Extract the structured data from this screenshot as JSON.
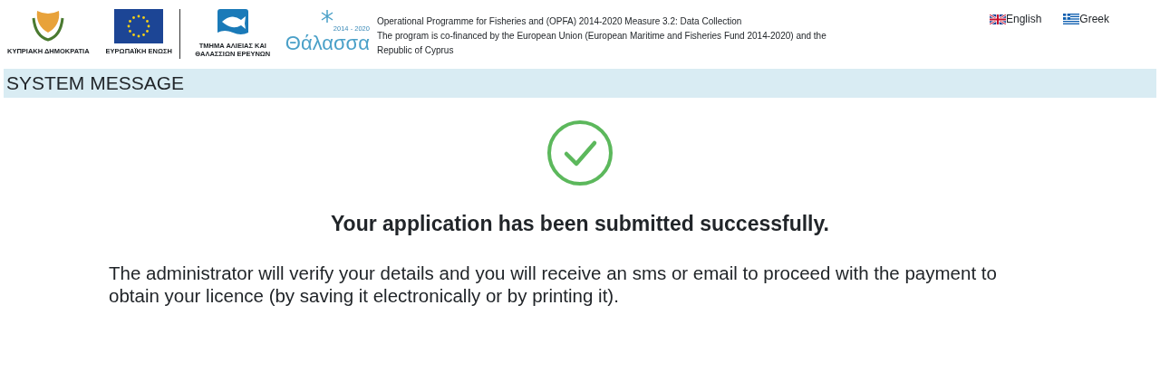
{
  "header": {
    "logos": [
      {
        "kind": "crest",
        "caption": "ΚΥΠΡΙΑΚΗ ΔΗΜΟΚΡΑΤΙΑ"
      },
      {
        "kind": "eu",
        "caption": "ΕΥΡΩΠΑΪΚΗ ΕΝΩΣΗ"
      },
      {
        "kind": "fish",
        "caption": "ΤΜΗΜΑ ΑΛΙΕΙΑΣ ΚΑΙ ΘΑΛΑΣΣΙΩΝ ΕΡΕΥΝΩΝ"
      },
      {
        "kind": "thalassa",
        "caption": "Θάλασσα",
        "years": "2014 - 2020"
      }
    ],
    "lines": [
      "Operational Programme for Fisheries and (OPFA) 2014-2020 Measure 3.2: Data Collection",
      "The program is co-financed by the European Union (European Maritime and Fisheries Fund 2014-2020) and the Republic of Cyprus"
    ],
    "languages": [
      {
        "kind": "uk",
        "label": "English"
      },
      {
        "kind": "gr",
        "label": "Greek"
      }
    ]
  },
  "banner": {
    "title": "SYSTEM MESSAGE"
  },
  "message": {
    "kind": "success",
    "heading": "Your application has been submitted successfully.",
    "body": "The administrator will verify your details and you will receive an sms or email to proceed with the payment to obtain your licence (by saving it electronically or by printing it)."
  }
}
